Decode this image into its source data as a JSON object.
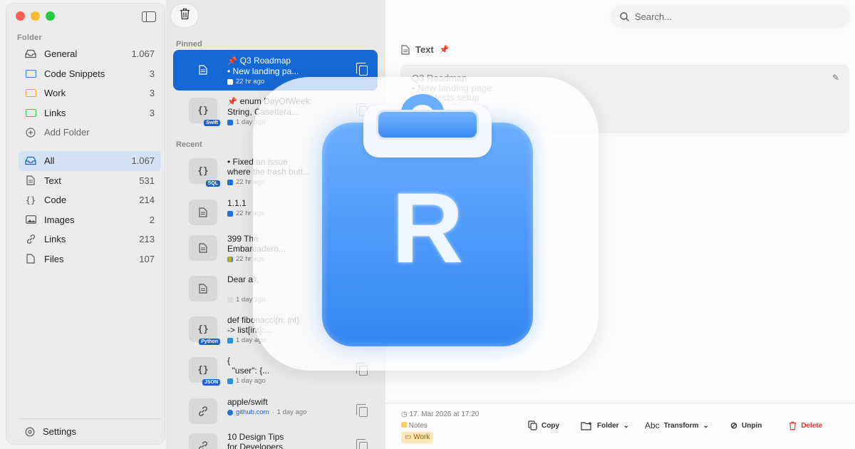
{
  "sidebar": {
    "folder_label": "Folder",
    "folders": [
      {
        "label": "General",
        "count": "1.067"
      },
      {
        "label": "Code Snippets",
        "count": "3"
      },
      {
        "label": "Work",
        "count": "3"
      },
      {
        "label": "Links",
        "count": "3"
      },
      {
        "label": "Add Folder",
        "count": ""
      }
    ],
    "types": [
      {
        "label": "All",
        "count": "1.067"
      },
      {
        "label": "Text",
        "count": "531"
      },
      {
        "label": "Code",
        "count": "214"
      },
      {
        "label": "Images",
        "count": "2"
      },
      {
        "label": "Links",
        "count": "213"
      },
      {
        "label": "Files",
        "count": "107"
      }
    ],
    "settings_label": "Settings",
    "colors": {
      "general": "#666666",
      "code_snippets": "#2f7de1",
      "work": "#f0a334",
      "links": "#34c759"
    }
  },
  "list": {
    "pinned_label": "Pinned",
    "recent_label": "Recent",
    "pinned": [
      {
        "line1": "Q3 Roadmap",
        "line2": "• New landing pa...",
        "meta": "22 hr ago",
        "icon": "document-icon",
        "badge": ""
      },
      {
        "line1": "enum DayOfWeek:",
        "line2": "String, CaseItera...",
        "meta": "1 day ago",
        "icon": "code-icon",
        "badge": "Swift"
      }
    ],
    "recent": [
      {
        "line1": "• Fixed an issue",
        "line2": "where the trash butt...",
        "meta": "22 hr ago",
        "icon": "code-icon",
        "badge": "SQL"
      },
      {
        "line1": "1.1.1",
        "line2": "",
        "meta": "22 hr ago",
        "icon": "document-icon",
        "badge": ""
      },
      {
        "line1": "399 The",
        "line2": "Embarcadero...",
        "meta": "22 hr ago",
        "icon": "document-icon",
        "badge": ""
      },
      {
        "line1": "Dear all,",
        "line2": "",
        "meta": "1 day ago",
        "icon": "document-icon",
        "badge": ""
      },
      {
        "line1": "def fibonacci(n: int)",
        "line2": "-> list[int]:...",
        "meta": "1 day ago",
        "icon": "code-icon",
        "badge": "Python"
      },
      {
        "line1": "{",
        "line2": "  \"user\": {...",
        "meta": "1 day ago",
        "icon": "code-icon",
        "badge": "JSON"
      },
      {
        "line1": "apple/swift",
        "line2": "",
        "meta_link": "github.com",
        "meta": "1 day ago",
        "icon": "link-icon",
        "badge": ""
      },
      {
        "line1": "10 Design Tips",
        "line2": "for Developers",
        "meta": "",
        "icon": "link-icon",
        "badge": ""
      }
    ]
  },
  "detail": {
    "search_placeholder": "Search...",
    "type_label": "Text",
    "content_lines": [
      "Q3 Roadmap",
      "• New landing page",
      "• A/B tests setup",
      "• Feedback review",
      "• Notification center"
    ],
    "timestamp": "17. Mar 2026 at 17:20",
    "source_app": "Notes",
    "folder_tag": "Work",
    "actions": {
      "copy": "Copy",
      "folder": "Folder",
      "transform": "Transform",
      "unpin": "Unpin",
      "delete": "Delete"
    }
  },
  "logo": {
    "letter": "R"
  }
}
